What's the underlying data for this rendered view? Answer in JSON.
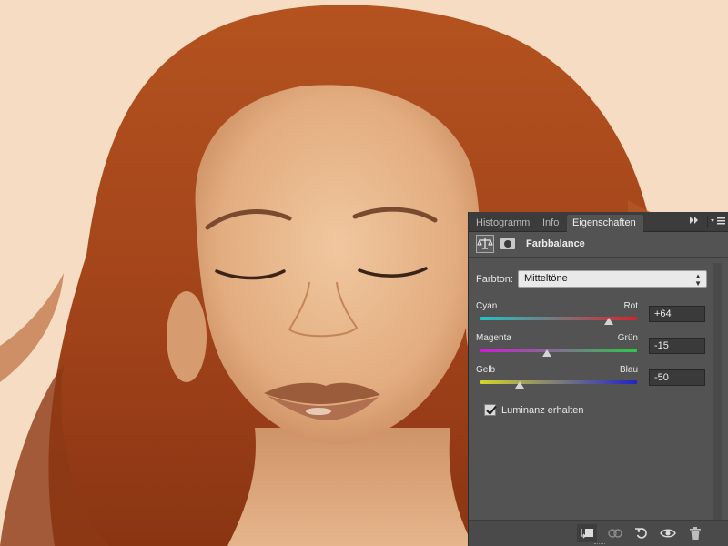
{
  "panel": {
    "tabs": [
      {
        "label": "Histogramm",
        "active": false
      },
      {
        "label": "Info",
        "active": false
      },
      {
        "label": "Eigenschaften",
        "active": true
      }
    ],
    "collapse_icon": "double-chevron-right-icon",
    "menu_icon": "panel-menu-icon",
    "header": {
      "adjustment_icon": "color-balance-icon",
      "mask_icon": "layer-mask-icon",
      "title": "Farbbalance"
    },
    "tone": {
      "label": "Farbton:",
      "selected": "Mitteltöne"
    },
    "sliders": [
      {
        "left": "Cyan",
        "right": "Rot",
        "value": "+64",
        "level": 64
      },
      {
        "left": "Magenta",
        "right": "Grün",
        "value": "-15",
        "level": -15
      },
      {
        "left": "Gelb",
        "right": "Blau",
        "value": "-50",
        "level": -50
      }
    ],
    "preserve_luminosity": {
      "label": "Luminanz erhalten",
      "checked": true
    },
    "footer_icons": [
      "clip-to-layer-icon",
      "view-previous-state-icon",
      "reset-icon",
      "visibility-eye-icon",
      "delete-trash-icon"
    ]
  },
  "colors": {
    "panel_bg": "#535353",
    "tabbar_bg": "#3c3c3c",
    "photo_tone": "#f6dcc2",
    "hair": "#a9461a"
  }
}
